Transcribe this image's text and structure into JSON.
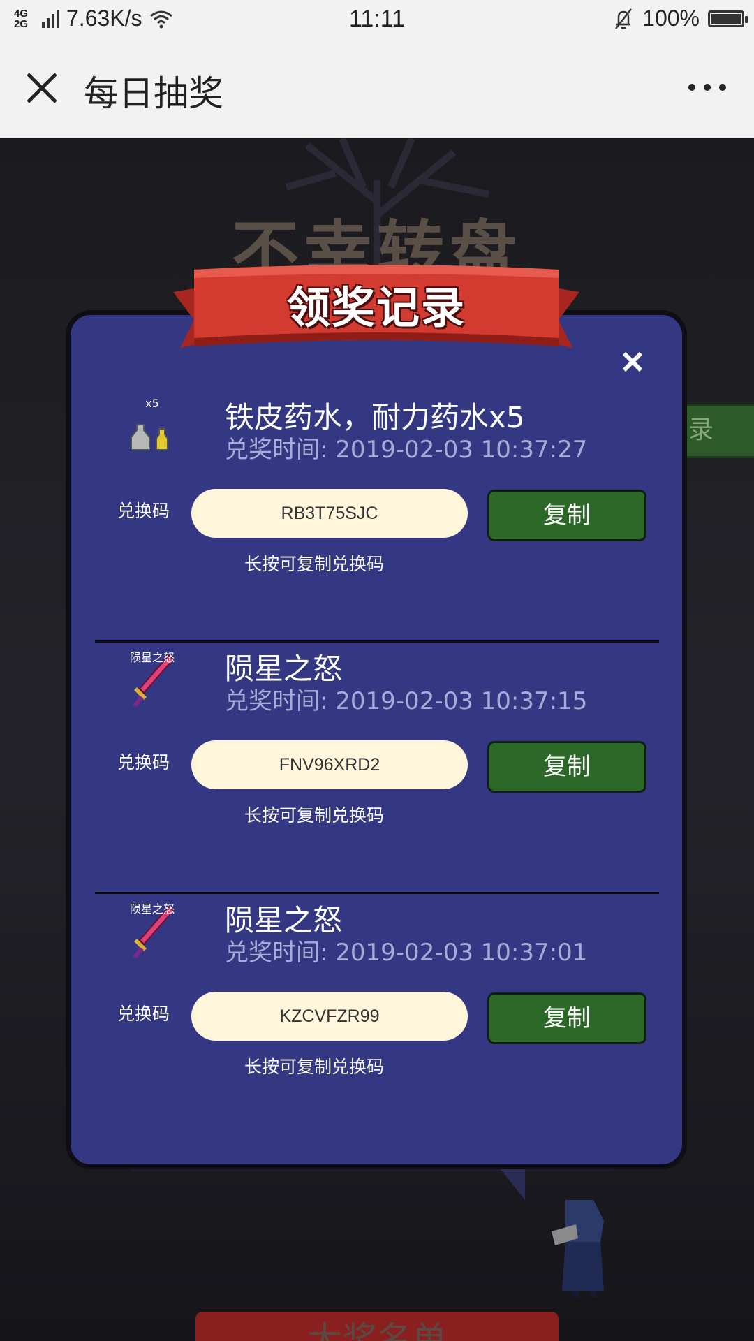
{
  "status_bar": {
    "network": "4G 2G",
    "speed": "7.63K/s",
    "time": "11:11",
    "battery": "100%"
  },
  "nav": {
    "title": "每日抽奖"
  },
  "background": {
    "game_title": "不幸转盘",
    "side_button_label": "录",
    "bottom_banner_text": "大奖名单"
  },
  "modal": {
    "title": "领奖记录",
    "records": [
      {
        "icon_caption": "x5",
        "icon": "potion-icon",
        "name": "铁皮药水，耐力药水x5",
        "time": "兑奖时间: 2019-02-03 10:37:27",
        "code_label": "兑换码",
        "code": "RB3T75SJC",
        "copy_label": "复制",
        "hint": "长按可复制兑换码"
      },
      {
        "icon_caption": "陨星之怒",
        "icon": "sword-icon",
        "name": "陨星之怒",
        "time": "兑奖时间: 2019-02-03 10:37:15",
        "code_label": "兑换码",
        "code": "FNV96XRD2",
        "copy_label": "复制",
        "hint": "长按可复制兑换码"
      },
      {
        "icon_caption": "陨星之怒",
        "icon": "sword-icon",
        "name": "陨星之怒",
        "time": "兑奖时间: 2019-02-03 10:37:01",
        "code_label": "兑换码",
        "code": "KZCVFZR99",
        "copy_label": "复制",
        "hint": "长按可复制兑换码"
      }
    ]
  },
  "colors": {
    "modal_bg": "#343781",
    "copy_button": "#2c6928",
    "code_field": "#fff6dc",
    "ribbon": "#d33a30"
  }
}
